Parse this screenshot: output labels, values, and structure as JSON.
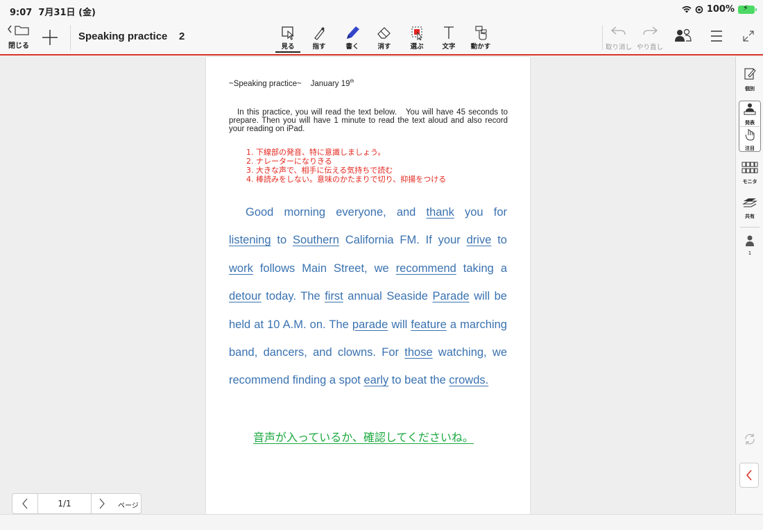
{
  "status": {
    "time": "9:07",
    "date": "7月31日 (金)",
    "battery": "100%"
  },
  "toolbar": {
    "close_label": "閉じる",
    "title": "Speaking practice    2",
    "tools": [
      "見る",
      "指す",
      "書く",
      "消す",
      "選ぶ",
      "文字",
      "動かす"
    ],
    "undo_label": "取り消し",
    "redo_label": "やり直し"
  },
  "document": {
    "header": "~Speaking practice~    January 19",
    "header_sup": "th",
    "instructions": "In this practice, you will read the text below.   You will have 45 seconds to prepare. Then you will have 1 minute to read the text aloud and also record your reading on iPad.",
    "points": [
      "1. 下線部の発音、特に意識しましょう。",
      "2. ナレーターになりきる",
      "3. 大きな声で、相手に伝える気持ちで読む",
      "4. 棒読みをしない。意味のかたまりで切り、抑揚をつける"
    ],
    "reading": [
      {
        "t": "Good morning everyone, and ",
        "u": false
      },
      {
        "t": "thank",
        "u": true
      },
      {
        "t": " you for ",
        "u": false
      },
      {
        "t": "listening",
        "u": true
      },
      {
        "t": " to ",
        "u": false
      },
      {
        "t": "Southern",
        "u": true
      },
      {
        "t": " California FM. If your ",
        "u": false
      },
      {
        "t": "drive",
        "u": true
      },
      {
        "t": " to ",
        "u": false
      },
      {
        "t": "work",
        "u": true
      },
      {
        "t": " follows Main Street, we ",
        "u": false
      },
      {
        "t": "recommend",
        "u": true
      },
      {
        "t": " taking a ",
        "u": false
      },
      {
        "t": "detour",
        "u": true
      },
      {
        "t": " today. The ",
        "u": false
      },
      {
        "t": "first",
        "u": true
      },
      {
        "t": " annual Seaside ",
        "u": false
      },
      {
        "t": "Parade",
        "u": true
      },
      {
        "t": " will be held at 10 A.M. on. The ",
        "u": false
      },
      {
        "t": "parade",
        "u": true
      },
      {
        "t": " will ",
        "u": false
      },
      {
        "t": "feature",
        "u": true
      },
      {
        "t": " a marching band, dancers, and clowns. For ",
        "u": false
      },
      {
        "t": "those",
        "u": true
      },
      {
        "t": " watching, we recommend finding a spot ",
        "u": false
      },
      {
        "t": "early",
        "u": true
      },
      {
        "t": " to beat the ",
        "u": false
      },
      {
        "t": "crowds.",
        "u": true
      }
    ],
    "note": "音声が入っているか、確認してくださいね。"
  },
  "rail": {
    "items": [
      "個別",
      "発表",
      "注目",
      "モニタ",
      "共有"
    ],
    "user_count": "1"
  },
  "pager": {
    "current": "1/1",
    "label": "ページ"
  },
  "colors": {
    "accent": "#d9342b",
    "reading_blue": "#3a72b0",
    "note_green": "#19a83e",
    "points_red": "#e4271f"
  }
}
